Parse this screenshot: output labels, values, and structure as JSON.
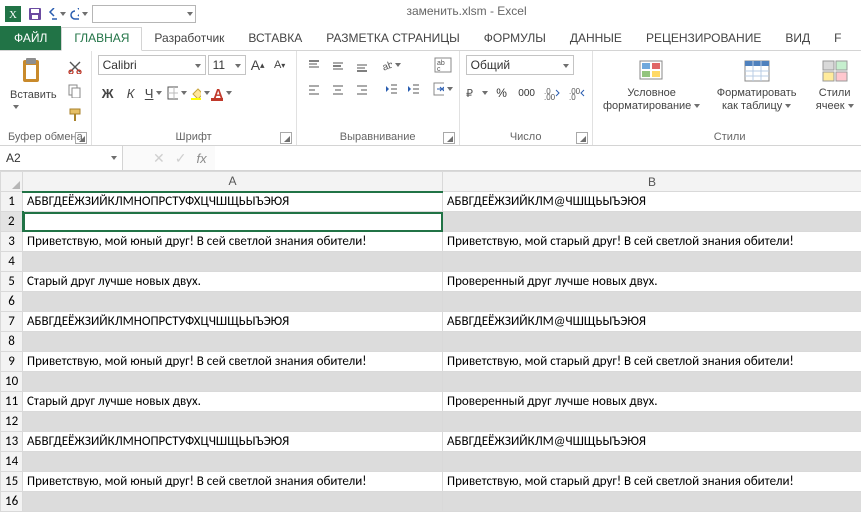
{
  "app": {
    "title": "заменить.xlsm - Excel"
  },
  "qat": {
    "namebox_value": ""
  },
  "tabs": {
    "file": "ФАЙЛ",
    "items": [
      {
        "label": "ГЛАВНАЯ",
        "active": true
      },
      {
        "label": "Разработчик"
      },
      {
        "label": "ВСТАВКА"
      },
      {
        "label": "РАЗМЕТКА СТРАНИЦЫ"
      },
      {
        "label": "ФОРМУЛЫ"
      },
      {
        "label": "ДАННЫЕ"
      },
      {
        "label": "РЕЦЕНЗИРОВАНИЕ"
      },
      {
        "label": "ВИД"
      },
      {
        "label": "F"
      }
    ]
  },
  "ribbon": {
    "clipboard": {
      "paste": "Вставить",
      "title": "Буфер обмена"
    },
    "font": {
      "name": "Calibri",
      "size": "11",
      "title": "Шрифт",
      "bold": "Ж",
      "italic": "К",
      "underline": "Ч"
    },
    "alignment": {
      "title": "Выравнивание"
    },
    "number": {
      "format": "Общий",
      "title": "Число",
      "percent": "%",
      "thousand": "000"
    },
    "cond": {
      "label": "Условное форматирование",
      "label1": "Условное",
      "label2": "форматирование"
    },
    "table": {
      "label": "Форматировать как таблицу",
      "label1": "Форматировать",
      "label2": "как таблицу"
    },
    "styles": {
      "label": "Стили ячеек",
      "label1": "Стили",
      "label2": "ячеек",
      "group_title": "Стили"
    }
  },
  "formula": {
    "name_box": "A2",
    "cancel": "✕",
    "accept": "✓",
    "fx": "fx",
    "value": ""
  },
  "sheet": {
    "columns": [
      "A",
      "B"
    ],
    "selected_row": 2,
    "selected_col": "A",
    "rows": [
      {
        "n": 1,
        "a": "АБВГДЕЁЖЗИЙКЛМНОПРСТУФХЦЧШЩЬЫЪЭЮЯ",
        "b": "АБВГДЕЁЖЗИЙКЛМ@ЧШЩЬЫЪЭЮЯ"
      },
      {
        "n": 2,
        "a": "",
        "b": "",
        "striped": true,
        "selected": true
      },
      {
        "n": 3,
        "a": "Приветствую, мой юный друг! В сей светлой знания обители!",
        "b": "Приветствую, мой старый друг! В сей светлой знания обители!"
      },
      {
        "n": 4,
        "a": "",
        "b": "",
        "striped": true
      },
      {
        "n": 5,
        "a": "Старый друг лучше новых двух.",
        "b": "Проверенный друг лучше новых двух."
      },
      {
        "n": 6,
        "a": "",
        "b": "",
        "striped": true
      },
      {
        "n": 7,
        "a": "АБВГДЕЁЖЗИЙКЛМНОПРСТУФХЦЧШЩЬЫЪЭЮЯ",
        "b": "АБВГДЕЁЖЗИЙКЛМ@ЧШЩЬЫЪЭЮЯ"
      },
      {
        "n": 8,
        "a": "",
        "b": "",
        "striped": true
      },
      {
        "n": 9,
        "a": "Приветствую, мой юный друг! В сей светлой знания обители!",
        "b": "Приветствую, мой старый друг! В сей светлой знания обители!"
      },
      {
        "n": 10,
        "a": "",
        "b": "",
        "striped": true
      },
      {
        "n": 11,
        "a": "Старый друг лучше новых двух.",
        "b": "Проверенный друг лучше новых двух."
      },
      {
        "n": 12,
        "a": "",
        "b": "",
        "striped": true
      },
      {
        "n": 13,
        "a": "АБВГДЕЁЖЗИЙКЛМНОПРСТУФХЦЧШЩЬЫЪЭЮЯ",
        "b": "АБВГДЕЁЖЗИЙКЛМ@ЧШЩЬЫЪЭЮЯ"
      },
      {
        "n": 14,
        "a": "",
        "b": "",
        "striped": true
      },
      {
        "n": 15,
        "a": "Приветствую, мой юный друг! В сей светлой знания обители!",
        "b": "Приветствую, мой старый друг! В сей светлой знания обители!"
      },
      {
        "n": 16,
        "a": "",
        "b": "",
        "striped": true
      }
    ]
  }
}
